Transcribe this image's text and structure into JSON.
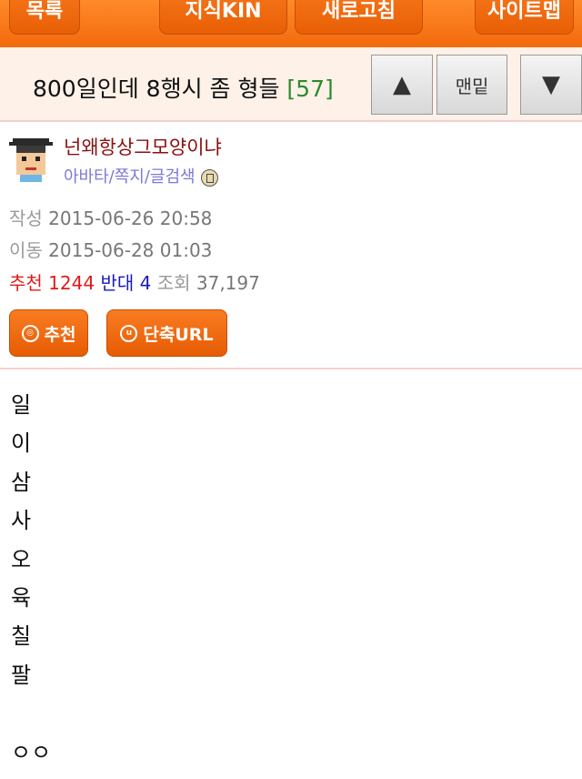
{
  "topbar": {
    "list_label": "목록",
    "kin_label": "지식KIN",
    "refresh_label": "새로고침",
    "sitemap_label": "사이트맵"
  },
  "post": {
    "title": "800일인데 8행시 좀 형들",
    "comment_count": "[57]"
  },
  "nav": {
    "up_symbol": "▲",
    "bottom_label": "맨밑",
    "down_symbol": "▼"
  },
  "author": {
    "nickname": "넌왜항상그모양이냐",
    "links": "아바타/쪽지/글검색"
  },
  "meta": {
    "written_label": "작성",
    "written_value": "2015-06-26 20:58",
    "moved_label": "이동",
    "moved_value": "2015-06-28 01:03",
    "recommend_label": "추천",
    "recommend_value": "1244",
    "oppose_label": "반대",
    "oppose_value": "4",
    "views_label": "조회",
    "views_value": "37,197"
  },
  "actions": {
    "recommend_button": "추천",
    "recommend_icon_glyph": "◎",
    "shorturl_button": "단축URL",
    "shorturl_icon_glyph": "u"
  },
  "body_lines": [
    "일",
    "이",
    "삼",
    "사",
    "오",
    "육",
    "칠",
    "팔",
    "",
    "ㅇㅇ"
  ],
  "colors": {
    "brand_orange": "#f26a0c",
    "title_bg": "#fdf1e8",
    "count_green": "#2e8b2e",
    "nickname": "#8b1010",
    "link_purple": "#7a7ad8",
    "recommend_red": "#e01a1a",
    "oppose_blue": "#1a1ab8"
  }
}
